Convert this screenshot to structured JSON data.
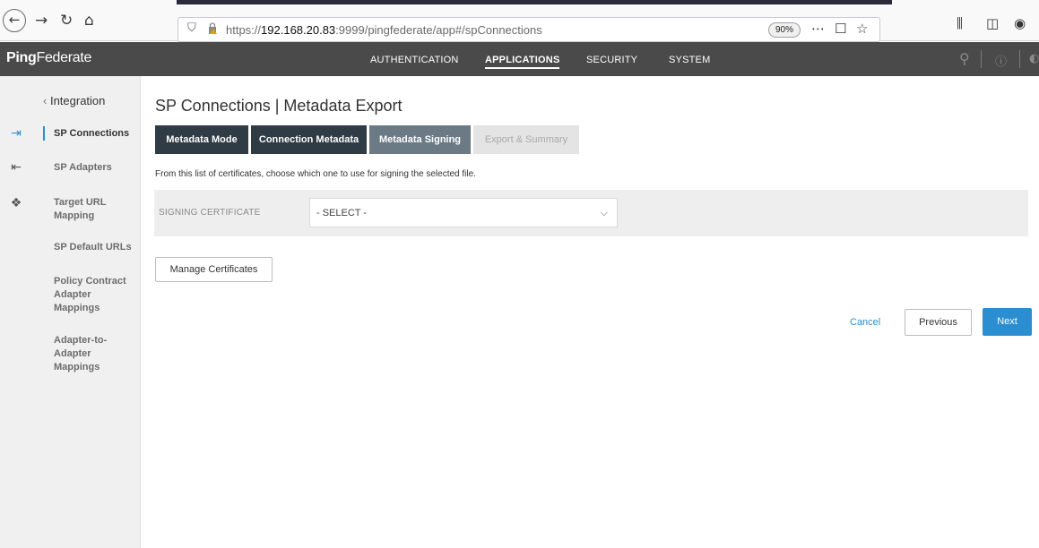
{
  "browser": {
    "url_prefix": "https://",
    "url_host": "192.168.20.83",
    "url_suffix": ":9999/pingfederate/app#/spConnections",
    "zoom": "90%"
  },
  "app": {
    "logo_bold": "Ping",
    "logo_rest": "Federate",
    "nav": [
      {
        "label": "AUTHENTICATION",
        "active": false
      },
      {
        "label": "APPLICATIONS",
        "active": true
      },
      {
        "label": "SECURITY",
        "active": false
      },
      {
        "label": "SYSTEM",
        "active": false
      }
    ]
  },
  "sidebar": {
    "back_label": "Integration",
    "items": [
      {
        "label": "SP Connections",
        "active": true
      },
      {
        "label": "SP Adapters",
        "active": false
      },
      {
        "label": "Target URL Mapping",
        "active": false
      },
      {
        "label": "SP Default URLs",
        "active": false
      },
      {
        "label": "Policy Contract Adapter Mappings",
        "active": false
      },
      {
        "label": "Adapter-to-Adapter Mappings",
        "active": false
      }
    ]
  },
  "main": {
    "title": "SP Connections | Metadata Export",
    "tabs": [
      {
        "label": "Metadata Mode",
        "state": "done"
      },
      {
        "label": "Connection Metadata",
        "state": "done"
      },
      {
        "label": "Metadata Signing",
        "state": "current"
      },
      {
        "label": "Export & Summary",
        "state": "future"
      }
    ],
    "instruction": "From this list of certificates, choose which one to use for signing the selected file.",
    "signing_label": "SIGNING CERTIFICATE",
    "signing_value": "- SELECT -",
    "manage_label": "Manage Certificates",
    "cancel_label": "Cancel",
    "previous_label": "Previous",
    "next_label": "Next"
  },
  "colors": {
    "accent": "#2a8ed0",
    "header": "#4a4a4a",
    "tab_done": "#2f3b45",
    "tab_current": "#6b7a85"
  }
}
